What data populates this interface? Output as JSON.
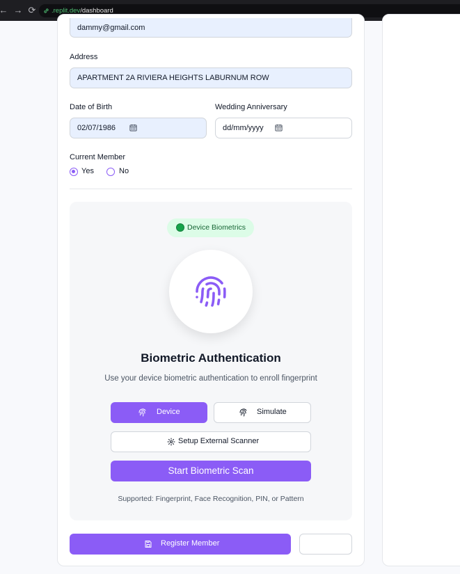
{
  "browser": {
    "url_subdomain_hidden": "",
    "url_host": ".replit.dev",
    "url_path": "/dashboard"
  },
  "form": {
    "email_value": "dammy@gmail.com",
    "address_label": "Address",
    "address_value": "APARTMENT 2A RIVIERA HEIGHTS LABURNUM ROW",
    "dob_label": "Date of Birth",
    "dob_value": "02/07/1986",
    "anniversary_label": "Wedding Anniversary",
    "anniversary_value": "dd/mm/yyyy",
    "current_member_label": "Current Member",
    "radio_yes": "Yes",
    "radio_no": "No",
    "current_member_selected": "Yes"
  },
  "biometric": {
    "badge": "Device Biometrics",
    "title": "Biometric Authentication",
    "subtitle": "Use your device biometric authentication to enroll fingerprint",
    "device_button": "Device",
    "simulate_button": "Simulate",
    "external_button": "Setup External Scanner",
    "start_button": "Start Biometric Scan",
    "supported": "Supported: Fingerprint, Face Recognition, PIN, or Pattern"
  },
  "footer": {
    "register_button": "Register Member",
    "secondary_button": ""
  },
  "colors": {
    "accent": "#8b5cf6",
    "badge_bg": "#dcfce7",
    "badge_dot": "#16a34a",
    "input_fill": "#e8f0fe"
  }
}
